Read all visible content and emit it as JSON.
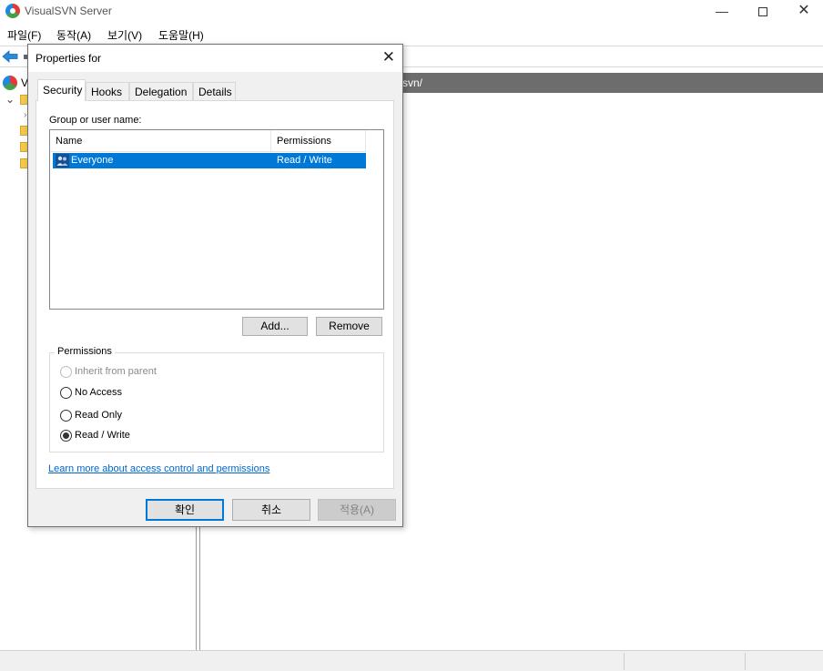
{
  "window": {
    "title": "VisualSVN Server",
    "controls": {
      "minimize": "—",
      "maximize": "",
      "close": "✕"
    }
  },
  "menu": [
    "파일(F)",
    "동작(A)",
    "보기(V)",
    "도움말(H)"
  ],
  "tree": {
    "root_label": "V"
  },
  "content_header": {
    "path_fragment": "svn/"
  },
  "dialog": {
    "title": "Properties for",
    "close": "✕",
    "tabs": [
      "Security",
      "Hooks",
      "Delegation",
      "Details"
    ],
    "active_tab": "Security",
    "group_label": "Group or user name:",
    "list": {
      "columns": [
        "Name",
        "Permissions"
      ],
      "rows": [
        {
          "name": "Everyone",
          "permission": "Read / Write",
          "selected": true
        }
      ]
    },
    "add_button": "Add...",
    "remove_button": "Remove",
    "permissions": {
      "title": "Permissions",
      "options": [
        {
          "label": "Inherit from parent",
          "enabled": false,
          "checked": false
        },
        {
          "label": "No Access",
          "enabled": true,
          "checked": false
        },
        {
          "label": "Read Only",
          "enabled": true,
          "checked": false
        },
        {
          "label": "Read / Write",
          "enabled": true,
          "checked": true
        }
      ]
    },
    "learn_more_link": "Learn more about access control and permissions",
    "ok_button": "확인",
    "cancel_button": "취소",
    "apply_button": "적용(A)"
  },
  "colors": {
    "selection": "#0078d7",
    "link": "#0066cc",
    "header_bar": "#6d6d6d",
    "folder": "#f2c94c"
  }
}
